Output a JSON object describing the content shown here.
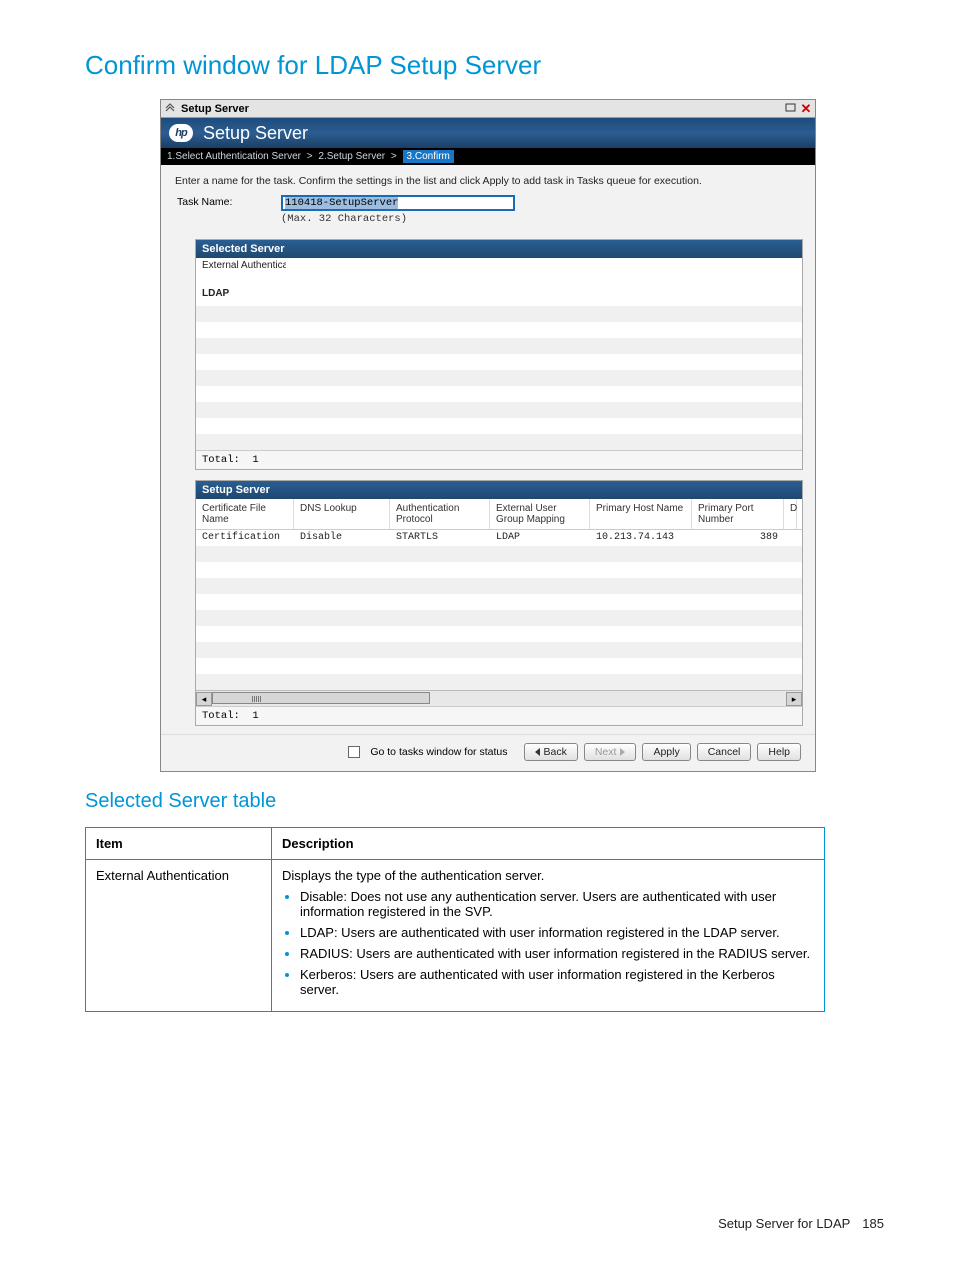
{
  "page_title": "Confirm window for LDAP Setup Server",
  "window": {
    "titlebar_text": "Setup Server",
    "header_title": "Setup Server",
    "breadcrumbs": [
      {
        "label": "1.Select Authentication Server",
        "active": false
      },
      {
        "label": "2.Setup Server",
        "active": false
      },
      {
        "label": "3.Confirm",
        "active": true
      }
    ],
    "instruction": "Enter a name for the task. Confirm the settings in the list and click Apply to add task in Tasks queue for execution.",
    "task": {
      "label": "Task Name:",
      "value": "110418-SetupServer",
      "hint": "(Max. 32 Characters)"
    },
    "selected_server": {
      "title": "Selected Server",
      "rows": [
        {
          "label": "External Authentication",
          "value": ""
        },
        {
          "label": "LDAP",
          "value": ""
        }
      ],
      "total_label": "Total:",
      "total_value": "1"
    },
    "setup_server": {
      "title": "Setup Server",
      "columns": [
        "Certificate File Name",
        "DNS Lookup",
        "Authentication Protocol",
        "External User Group Mapping",
        "Primary Host Name",
        "Primary Port Number",
        "D"
      ],
      "rows": [
        {
          "cert": "Certification",
          "dns": "Disable",
          "auth": "STARTLS",
          "eugm": "LDAP",
          "host": "10.213.74.143",
          "port": "389",
          "d": ""
        }
      ],
      "total_label": "Total:",
      "total_value": "1"
    },
    "actions": {
      "status_checkbox_label": "Go to tasks window for status",
      "back": "Back",
      "next": "Next",
      "apply": "Apply",
      "cancel": "Cancel",
      "help": "Help"
    }
  },
  "subsection_title": "Selected Server table",
  "desc_table": {
    "header_item": "Item",
    "header_desc": "Description",
    "item": "External Authentication",
    "desc_intro": "Displays the type of the authentication server.",
    "bullets": [
      "Disable: Does not use any authentication server. Users are authenticated with user information registered in the SVP.",
      "LDAP: Users are authenticated with user information registered in the LDAP server.",
      "RADIUS: Users are authenticated with user information registered in the RADIUS server.",
      "Kerberos: Users are authenticated with user information registered in the Kerberos server."
    ]
  },
  "footer": {
    "text": "Setup Server for LDAP",
    "page_number": "185"
  }
}
